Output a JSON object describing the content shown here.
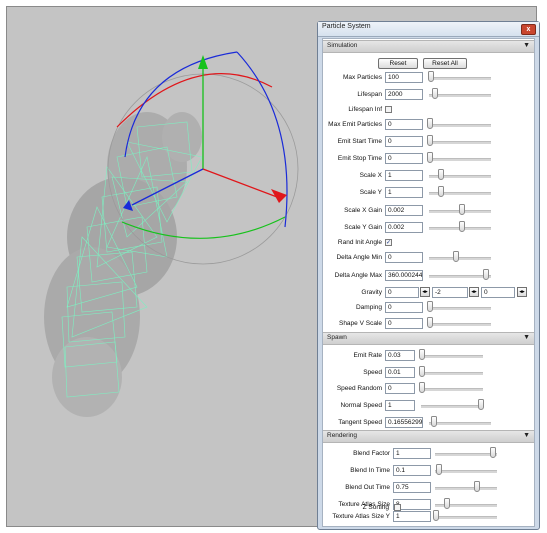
{
  "panel": {
    "title": "Particle System",
    "close_label": "x",
    "collapse_arrow": "▼"
  },
  "simulation": {
    "header": "Simulation",
    "reset_label": "Reset",
    "reset_all_label": "Reset All",
    "max_particles": {
      "label": "Max Particles",
      "value": "100",
      "slider": 0.05
    },
    "lifespan": {
      "label": "Lifespan",
      "value": "2000",
      "slider": 0.08
    },
    "lifespan_inf": {
      "label": "Lifespan Inf",
      "checked": false
    },
    "max_emit_particles": {
      "label": "Max Emit Particles",
      "value": "0",
      "slider": 0.0
    },
    "emit_start_time": {
      "label": "Emit Start Time",
      "value": "0",
      "slider": 0.0
    },
    "emit_stop_time": {
      "label": "Emit Stop Time",
      "value": "0",
      "slider": 0.0
    },
    "scale_x": {
      "label": "Scale X",
      "value": "1",
      "slider": 0.2
    },
    "scale_y": {
      "label": "Scale Y",
      "value": "1",
      "slider": 0.2
    },
    "scale_x_gain": {
      "label": "Scale X Gain",
      "value": "0.002",
      "slider": 0.5
    },
    "scale_y_gain": {
      "label": "Scale Y Gain",
      "value": "0.002",
      "slider": 0.5
    },
    "rand_init_angle": {
      "label": "Rand Init Angle",
      "checked": true,
      "mark": "✓"
    },
    "delta_angle_min": {
      "label": "Delta Angle Min",
      "value": "0",
      "slider": 0.5
    },
    "delta_angle_max": {
      "label": "Delta Angle Max",
      "value": "360.00024414",
      "slider": 1.0
    },
    "gravity": {
      "label": "Gravity",
      "x": "0",
      "y": "-2",
      "z": "0",
      "spin_icon": "◂▸"
    },
    "damping": {
      "label": "Damping",
      "value": "0",
      "slider": 0.0
    },
    "shape_v_scale": {
      "label": "Shape V Scale",
      "value": "0",
      "slider": 0.0
    }
  },
  "spawn": {
    "header": "Spawn",
    "emit_rate": {
      "label": "Emit Rate",
      "value": "0.03",
      "slider": 0.0
    },
    "speed": {
      "label": "Speed",
      "value": "0.01",
      "slider": 0.0
    },
    "speed_random": {
      "label": "Speed Random",
      "value": "0",
      "slider": 0.0
    },
    "normal_speed": {
      "label": "Normal Speed",
      "value": "1",
      "slider": 1.0
    },
    "tangent_speed": {
      "label": "Tangent Speed",
      "value": "0.16556299",
      "slider": 0.1
    }
  },
  "rendering": {
    "header": "Rendering",
    "blend_factor": {
      "label": "Blend Factor",
      "value": "1",
      "slider": 1.0
    },
    "blend_in_time": {
      "label": "Blend In Time",
      "value": "0.1",
      "slider": 0.05
    },
    "blend_out_time": {
      "label": "Blend Out Time",
      "value": "0.75",
      "slider": 0.65
    },
    "texture_atlas_size": {
      "label": "Texture Atlas Size",
      "value": "8",
      "slider": 0.2
    },
    "texture_atlas_size_y": {
      "label": "Texture Atlas Size Y",
      "value": "1",
      "slider": 0.0
    },
    "z_sorting": {
      "label": "Z Sorting",
      "checked": false
    }
  },
  "viewport": {
    "gizmo_x_color": "#e0161a",
    "gizmo_y_color": "#17c21c",
    "gizmo_z_color": "#1a2bd8",
    "wire_color": "#7ef0c2"
  }
}
